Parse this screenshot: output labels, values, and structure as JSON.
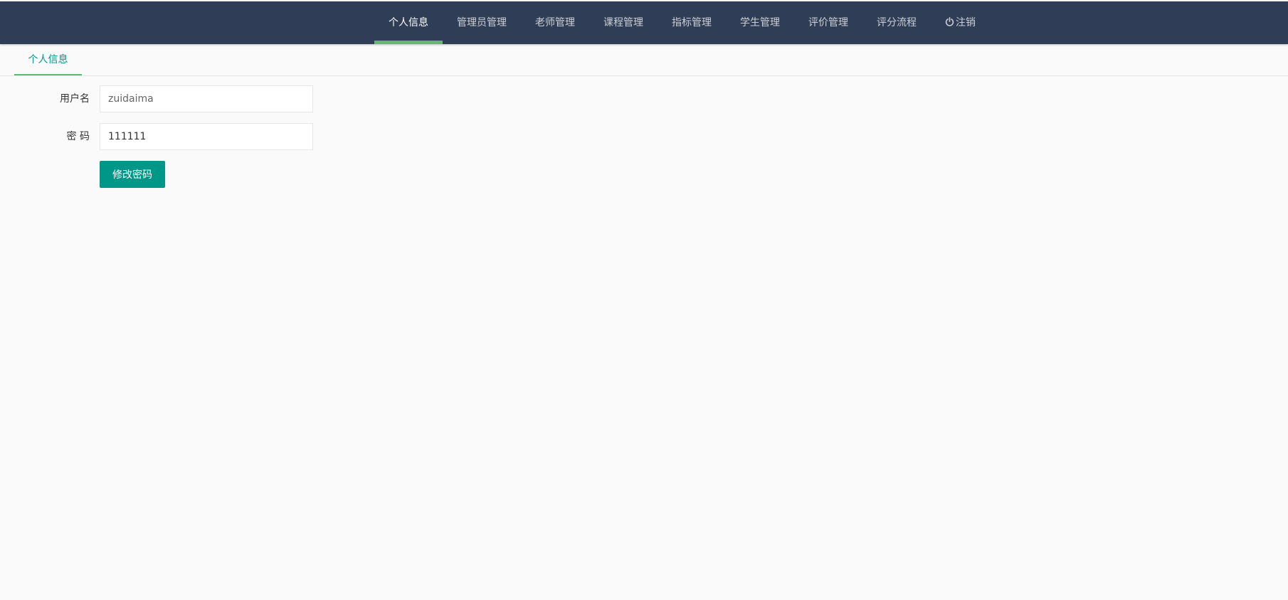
{
  "nav": {
    "items": [
      {
        "label": "个人信息",
        "active": true
      },
      {
        "label": "管理员管理"
      },
      {
        "label": "老师管理"
      },
      {
        "label": "课程管理"
      },
      {
        "label": "指标管理"
      },
      {
        "label": "学生管理"
      },
      {
        "label": "评价管理"
      },
      {
        "label": "评分流程"
      }
    ],
    "logout": {
      "icon": "power-icon",
      "label": "注销"
    }
  },
  "tabs": [
    {
      "label": "个人信息",
      "active": true
    }
  ],
  "form": {
    "username": {
      "label": "用户名",
      "value": "zuidaima"
    },
    "password": {
      "label": "密 码",
      "value": "111111"
    },
    "submit_label": "修改密码"
  },
  "colors": {
    "topbar": "#2f3e56",
    "accent": "#009688",
    "active_indicator": "#5fb878",
    "background": "#fafafa"
  }
}
